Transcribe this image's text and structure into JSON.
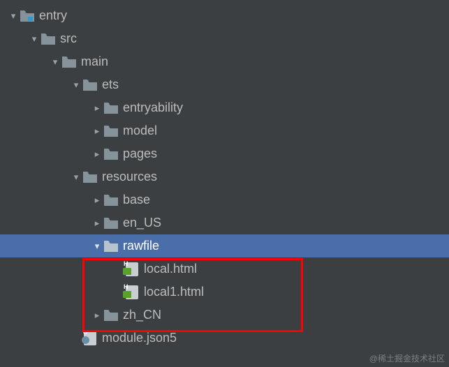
{
  "tree": {
    "entry": "entry",
    "src": "src",
    "main": "main",
    "ets": "ets",
    "entryability": "entryability",
    "model": "model",
    "pages": "pages",
    "resources": "resources",
    "base": "base",
    "en_us": "en_US",
    "rawfile": "rawfile",
    "local_html": "local.html",
    "local1_html": "local1.html",
    "zh_cn": "zh_CN",
    "module_json5": "module.json5"
  },
  "watermark": "@稀土掘金技术社区"
}
